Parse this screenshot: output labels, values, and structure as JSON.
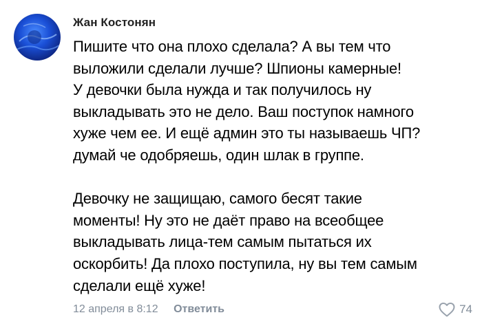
{
  "comment": {
    "author": "Жан Костонян",
    "text_lines": [
      "Пишите что она плохо сделала? А вы тем что",
      "выложили  сделали лучше? Шпионы камерные!",
      "У девочки была нужда и так получилось ну",
      "выкладывать это не дело. Ваш поступок намного",
      "хуже чем ее. И ещё админ это ты называешь ЧП?",
      "думай че одобряешь, один шлак в группе.",
      "",
      "Девочку не защищаю, самого бесят такие",
      "моменты! Ну это не даёт право на всеобщее",
      "выкладывать лица-тем самым пытаться их",
      "оскорбить! Да плохо поступила, ну вы тем самым",
      "сделали ещё хуже!"
    ],
    "date": "12 апреля в 8:12",
    "reply_label": "Ответить",
    "likes_count": "74"
  },
  "colors": {
    "meta_text": "#818c99",
    "author_text": "#222222",
    "body_text": "#000000",
    "avatar_primary": "#1a4fd6"
  },
  "icons": {
    "like": "heart-outline-icon",
    "avatar": "user-avatar"
  }
}
